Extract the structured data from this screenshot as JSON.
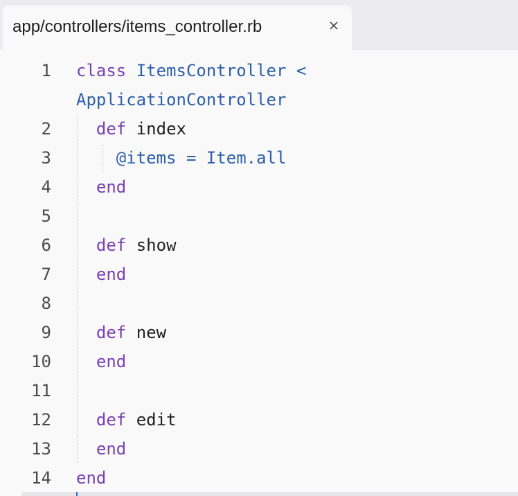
{
  "tab": {
    "title": "app/controllers/items_controller.rb",
    "close_icon": "close-icon"
  },
  "lines": [
    {
      "num": "1",
      "tokens": [
        [
          "kw",
          "class"
        ],
        [
          "plain",
          " "
        ],
        [
          "const",
          "ItemsController"
        ],
        [
          "plain",
          " "
        ],
        [
          "op",
          "<"
        ]
      ]
    },
    {
      "num": "",
      "tokens": [
        [
          "const",
          "ApplicationController"
        ]
      ]
    },
    {
      "num": "2",
      "tokens": [
        [
          "plain",
          "  "
        ],
        [
          "kw",
          "def"
        ],
        [
          "plain",
          " index"
        ]
      ]
    },
    {
      "num": "3",
      "tokens": [
        [
          "plain",
          "    "
        ],
        [
          "ivar",
          "@items"
        ],
        [
          "plain",
          " "
        ],
        [
          "op",
          "="
        ],
        [
          "plain",
          " "
        ],
        [
          "const",
          "Item.all"
        ]
      ]
    },
    {
      "num": "4",
      "tokens": [
        [
          "plain",
          "  "
        ],
        [
          "kw",
          "end"
        ]
      ]
    },
    {
      "num": "5",
      "tokens": []
    },
    {
      "num": "6",
      "tokens": [
        [
          "plain",
          "  "
        ],
        [
          "kw",
          "def"
        ],
        [
          "plain",
          " show"
        ]
      ]
    },
    {
      "num": "7",
      "tokens": [
        [
          "plain",
          "  "
        ],
        [
          "kw",
          "end"
        ]
      ]
    },
    {
      "num": "8",
      "tokens": []
    },
    {
      "num": "9",
      "tokens": [
        [
          "plain",
          "  "
        ],
        [
          "kw",
          "def"
        ],
        [
          "plain",
          " new"
        ]
      ]
    },
    {
      "num": "10",
      "tokens": [
        [
          "plain",
          "  "
        ],
        [
          "kw",
          "end"
        ]
      ]
    },
    {
      "num": "11",
      "tokens": []
    },
    {
      "num": "12",
      "tokens": [
        [
          "plain",
          "  "
        ],
        [
          "kw",
          "def"
        ],
        [
          "plain",
          " edit"
        ]
      ]
    },
    {
      "num": "13",
      "tokens": [
        [
          "plain",
          "  "
        ],
        [
          "kw",
          "end"
        ]
      ]
    },
    {
      "num": "14",
      "tokens": [
        [
          "kw",
          "end"
        ]
      ]
    }
  ],
  "colors": {
    "keyword": "#7b3fb3",
    "constant": "#2d5fa8",
    "text": "#1f1f1f",
    "line_number": "#4a4a4a",
    "background": "#f9f9fa",
    "tabbar": "#ececf0"
  }
}
